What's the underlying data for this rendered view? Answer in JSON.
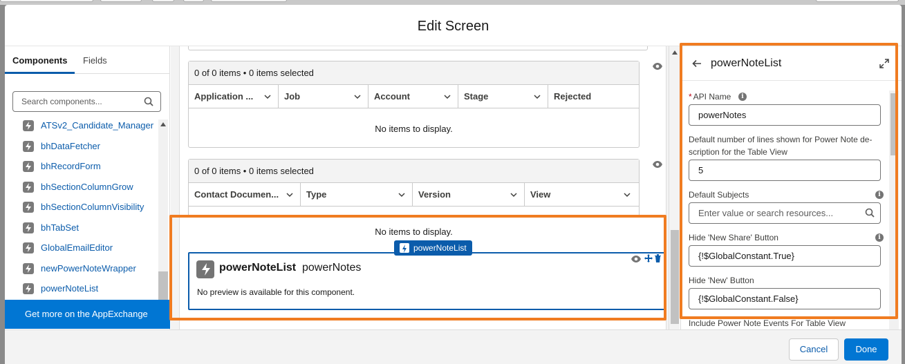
{
  "modal": {
    "title": "Edit Screen"
  },
  "left_panel": {
    "tabs": [
      {
        "label": "Components",
        "active": true
      },
      {
        "label": "Fields",
        "active": false
      }
    ],
    "search_placeholder": "Search components...",
    "components": [
      "ATSv2_Candidate_Manager",
      "bhDataFetcher",
      "bhRecordForm",
      "bhSectionColumnGrow",
      "bhSectionColumnVisibility",
      "bhTabSet",
      "GlobalEmailEditor",
      "newPowerNoteWrapper",
      "powerNoteList"
    ],
    "appexchange_label": "Get more on the AppExchange"
  },
  "canvas": {
    "table1": {
      "status": "0 of 0 items • 0 items selected",
      "columns": [
        "Application ...",
        "Job",
        "Account",
        "Stage",
        "Rejected"
      ],
      "empty_text": "No items to display."
    },
    "table2": {
      "status": "0 of 0 items • 0 items selected",
      "columns": [
        "Contact Documen...",
        "Type",
        "Version",
        "View"
      ],
      "empty_text": "No items to display."
    },
    "selected_component": {
      "badge": "powerNoteList",
      "name": "powerNoteList",
      "api_name": "powerNotes",
      "preview_text": "No preview is available for this component."
    }
  },
  "properties": {
    "title": "powerNoteList",
    "fields": [
      {
        "label": "API Name",
        "required": true,
        "info": true,
        "value": "powerNotes",
        "placeholder": ""
      },
      {
        "label": "Default number of lines shown for Power Note de-scription for the Table View",
        "required": false,
        "info": false,
        "value": "5",
        "placeholder": ""
      },
      {
        "label": "Default Subjects",
        "required": false,
        "info": true,
        "value": "",
        "placeholder": "Enter value or search resources..."
      },
      {
        "label": "Hide 'New Share' Button",
        "required": false,
        "info": true,
        "value": "{!$GlobalConstant.True}",
        "placeholder": ""
      },
      {
        "label": "Hide 'New' Button",
        "required": false,
        "info": false,
        "value": "{!$GlobalConstant.False}",
        "placeholder": ""
      },
      {
        "label": "Include Power Note Events For Table View",
        "required": false,
        "info": false,
        "value": "",
        "placeholder": ""
      }
    ]
  },
  "footer": {
    "cancel_label": "Cancel",
    "done_label": "Done"
  },
  "colors": {
    "brand": "#0176d3",
    "link": "#0b5cab",
    "highlight": "#f07c21"
  },
  "icons": [
    "search-icon",
    "lightning-icon",
    "eye-icon",
    "back-arrow-icon",
    "expand-icon",
    "info-icon",
    "chevron-down-icon",
    "move-icon",
    "trash-icon"
  ]
}
